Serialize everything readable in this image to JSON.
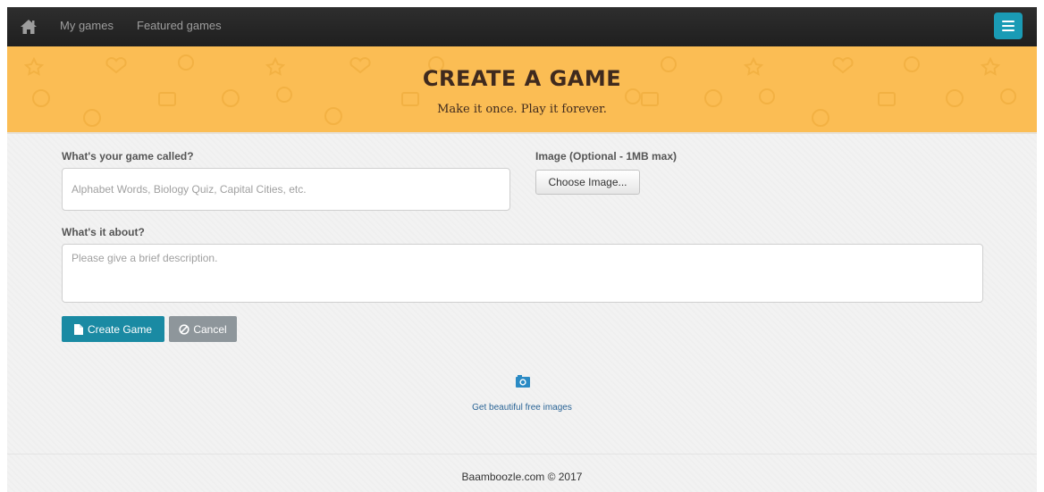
{
  "navbar": {
    "home_icon": "home-icon",
    "links": [
      "My games",
      "Featured games"
    ],
    "menu_icon": "hamburger-menu-icon",
    "menu_color": "#1a9bb5"
  },
  "banner": {
    "title": "Create a Game",
    "subtitle": "Make it once. Play it forever.",
    "background_color": "#fbbd54"
  },
  "form": {
    "name_label": "What's your game called?",
    "name_placeholder": "Alphabet Words, Biology Quiz, Capital Cities, etc.",
    "name_value": "",
    "image_label": "Image (Optional - 1MB max)",
    "image_button": "Choose Image...",
    "about_label": "What's it about?",
    "about_placeholder": "Please give a brief description.",
    "about_value": "",
    "create_button": "Create Game",
    "create_icon": "file-icon",
    "cancel_button": "Cancel",
    "cancel_icon": "ban-icon",
    "primary_color": "#1a8aa3"
  },
  "free_images": {
    "icon": "camera-icon",
    "link": "Get beautiful free images"
  },
  "footer": {
    "text": "Baamboozle.com © 2017"
  }
}
